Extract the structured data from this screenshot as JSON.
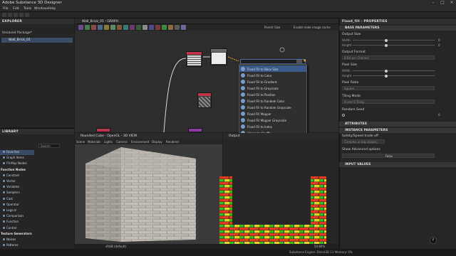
{
  "app": {
    "title": "Adobe Substance 3D Designer"
  },
  "menu": [
    "File",
    "Edit",
    "Tools",
    "Windows",
    "Help"
  ],
  "explorer": {
    "title": "EXPLORER",
    "package": "Unsaved Package*",
    "item": "Wall_Brick_01"
  },
  "graph": {
    "tab": "Wall_Brick_01 - GRAPH",
    "parent_size": "Parent Size",
    "enable_cache": "Enable node image cache",
    "search_value": ""
  },
  "dropdown": {
    "items": [
      "Flood Fill to Bbox Size",
      "Flood Fill to Color",
      "Flood Fill to Gradient",
      "Flood Fill to Grayscale",
      "Flood Fill to Position",
      "Flood Fill to Random Color",
      "Flood Fill to Random Grayscale",
      "Flood Fill Mapper",
      "Flood Fill Mapper Grayscale",
      "Flood Fill to Index",
      "Channels Shuffle",
      "Mirror Color"
    ],
    "selected_index": 0
  },
  "library": {
    "title": "LIBRARY",
    "search_placeholder": "Search",
    "items": [
      {
        "label": "Favorites",
        "cat": false,
        "sel": true
      },
      {
        "label": "Graph Items",
        "cat": false,
        "sel": false
      },
      {
        "label": "FX-Map Nodes",
        "cat": false,
        "sel": false
      },
      {
        "label": "Function Nodes",
        "cat": true,
        "sel": false
      },
      {
        "label": "Constant",
        "cat": false,
        "sel": false
      },
      {
        "label": "Vector",
        "cat": false,
        "sel": false
      },
      {
        "label": "Variables",
        "cat": false,
        "sel": false
      },
      {
        "label": "Samplers",
        "cat": false,
        "sel": false
      },
      {
        "label": "Cast",
        "cat": false,
        "sel": false
      },
      {
        "label": "Operator",
        "cat": false,
        "sel": false
      },
      {
        "label": "Logical",
        "cat": false,
        "sel": false
      },
      {
        "label": "Comparison",
        "cat": false,
        "sel": false
      },
      {
        "label": "Function",
        "cat": false,
        "sel": false
      },
      {
        "label": "Control",
        "cat": false,
        "sel": false
      },
      {
        "label": "Texture Generators",
        "cat": true,
        "sel": false
      },
      {
        "label": "Noises",
        "cat": false,
        "sel": false
      },
      {
        "label": "Patterns",
        "cat": false,
        "sel": false
      }
    ]
  },
  "view3d": {
    "title": "Rounded Cube - OpenGL - 3D VIEW",
    "menu": [
      "Scene",
      "Materials",
      "Lights",
      "Camera",
      "Environment",
      "Display",
      "Renderer"
    ],
    "color_space": "sRGB (default)"
  },
  "view2d": {
    "title": "Output",
    "zoom": "54.84%"
  },
  "properties": {
    "title": "Flood_fill - PROPERTIES",
    "base_params": "BASE PARAMETERS",
    "output_size": "Output Size",
    "width": "Width",
    "height": "Height",
    "width_val": "0",
    "height_val": "0",
    "relative": "Relative to parent",
    "output_format": "Output Format",
    "output_format_val": "8 Bit per Channel",
    "pixel_size": "Pixel Size",
    "pixel_ratio": "Pixel Ratio",
    "pixel_ratio_val": "Square",
    "tiling_mode": "Tiling Mode",
    "tiling_mode_val": "H and V Tiling",
    "random_seed": "Random Seed",
    "random_seed_val": "0",
    "attributes": "ATTRIBUTES",
    "instance_params": "INSTANCE PARAMETERS",
    "safety": "Safety/Speed trade-off",
    "safety_val": "Complex or big shapes",
    "advanced": "Show Advanced options",
    "advanced_val": "False",
    "input_values": "INPUT VALUES"
  },
  "status": "Substance Engine: Direct3D 11  Memory: 0%"
}
